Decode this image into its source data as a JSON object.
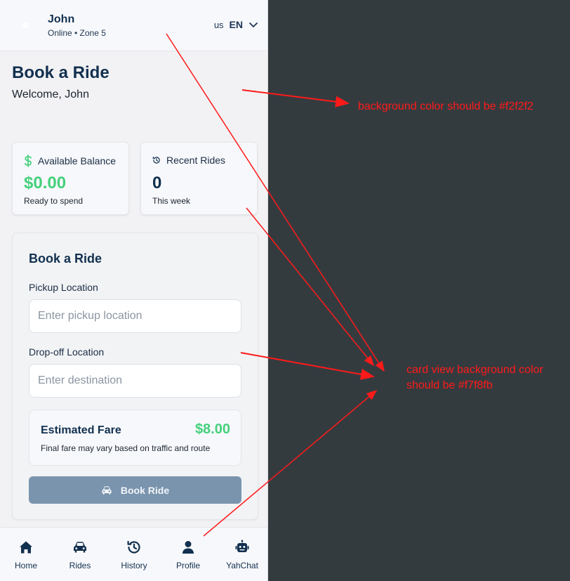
{
  "header": {
    "user_name": "John",
    "status": "Online • Zone 5",
    "language_flag": "us",
    "language_code": "EN"
  },
  "page": {
    "title": "Book a Ride",
    "welcome": "Welcome, John"
  },
  "stats": {
    "balance": {
      "label": "Available Balance",
      "value": "$0.00",
      "sub": "Ready to spend",
      "icon": "dollar-icon"
    },
    "recent": {
      "label": "Recent Rides",
      "value": "0",
      "sub": "This week",
      "icon": "history-icon"
    }
  },
  "booking": {
    "title": "Book a Ride",
    "pickup_label": "Pickup Location",
    "pickup_placeholder": "Enter pickup location",
    "pickup_value": "",
    "dropoff_label": "Drop-off Location",
    "dropoff_placeholder": "Enter destination",
    "dropoff_value": "",
    "fare_label": "Estimated Fare",
    "fare_value": "$8.00",
    "fare_note": "Final fare may vary based on traffic and route",
    "button_label": "Book Ride"
  },
  "nav": {
    "items": [
      {
        "label": "Home",
        "icon": "home-icon"
      },
      {
        "label": "Rides",
        "icon": "car-icon"
      },
      {
        "label": "History",
        "icon": "history-icon"
      },
      {
        "label": "Profile",
        "icon": "user-icon"
      },
      {
        "label": "YahChat",
        "icon": "robot-icon"
      }
    ]
  },
  "annotations": {
    "background_note": "background color should be #f2f2f2",
    "card_note": "card view background color should be #f7f8fb"
  },
  "colors": {
    "navy": "#12304f",
    "green": "#45d07c",
    "button": "#7a94ae",
    "annotation_red": "#ff1a1a",
    "dark_backdrop": "#343b3f"
  }
}
